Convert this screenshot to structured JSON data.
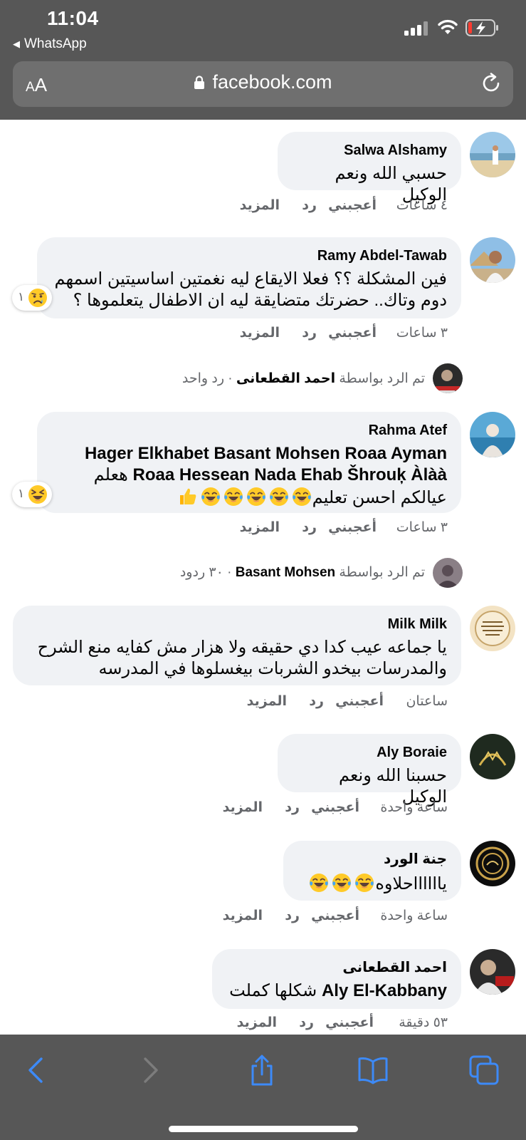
{
  "status_bar": {
    "time": "11:04",
    "back_app": "WhatsApp"
  },
  "browser": {
    "aa_small": "A",
    "aa_large": "A",
    "url": "facebook.com"
  },
  "comments": [
    {
      "name": "Salwa Alshamy",
      "text": "حسبي الله ونعم الوكيل",
      "time": "٤ ساعات",
      "like": "أعجبني",
      "reply": "رد",
      "more": "المزيد"
    },
    {
      "name": "Ramy Abdel-Tawab",
      "text_line1": "فين المشكلة ؟؟ فعلا الايقاع ليه نغمتين اساسيتين اسمهم",
      "text_line2": "دوم وتاك.. حضرتك متضايقة ليه ان الاطفال يتعلموها ؟",
      "time": "٣ ساعات",
      "like": "أعجبني",
      "reply": "رد",
      "more": "المزيد",
      "reaction_count": "١",
      "reaction_icon": "sad-face-icon",
      "replies": {
        "prefix": "تم الرد بواسطة",
        "by": "احمد القطعانى",
        "count": "· رد واحد"
      }
    },
    {
      "name": "Rahma Atef",
      "text_line1": "Hager Elkhabet Basant Mohsen Roaa Ayman",
      "text_line2_tags": "Roaa Hessean Nada Ehab Šhrouķ Àlàà",
      "text_line2_word": "هعلم",
      "text_line3": "عيالكم احسن تعليم",
      "time": "٣ ساعات",
      "like": "أعجبني",
      "reply": "رد",
      "more": "المزيد",
      "reaction_count": "١",
      "reaction_icon": "laughing-face-icon",
      "replies": {
        "prefix": "تم الرد بواسطة",
        "by": "Basant Mohsen",
        "count": "· ٣٠ ردود"
      }
    },
    {
      "name": "Milk Milk",
      "text_line1": "يا جماعه عيب كدا دي حقيقه ولا هزار مش كفايه منع الشرح",
      "text_line2": "والمدرسات بيخدو الشربات بيغسلوها في المدرسه",
      "time": "ساعتان",
      "like": "أعجبني",
      "reply": "رد",
      "more": "المزيد"
    },
    {
      "name": "Aly Boraie",
      "text": "حسبنا الله ونعم الوكيل",
      "time": "ساعة واحدة",
      "like": "أعجبني",
      "reply": "رد",
      "more": "المزيد"
    },
    {
      "name": "جنة الورد",
      "text": "يااااااحلاوه",
      "time": "ساعة واحدة",
      "like": "أعجبني",
      "reply": "رد",
      "more": "المزيد"
    },
    {
      "name": "احمد القطعانى",
      "tag": "Aly El-Kabbany",
      "text": "شكلها كملت",
      "time": "٥٣ دقيقة",
      "like": "أعجبني",
      "reply": "رد",
      "more": "المزيد"
    }
  ],
  "colors": {
    "chrome": "#575757",
    "bubble": "#f0f2f5",
    "meta_text": "#65676b",
    "ios_blue": "#3d8af7"
  },
  "toolbar": {
    "icons": [
      "back-icon",
      "forward-icon",
      "share-icon",
      "bookmarks-icon",
      "tabs-icon"
    ]
  }
}
